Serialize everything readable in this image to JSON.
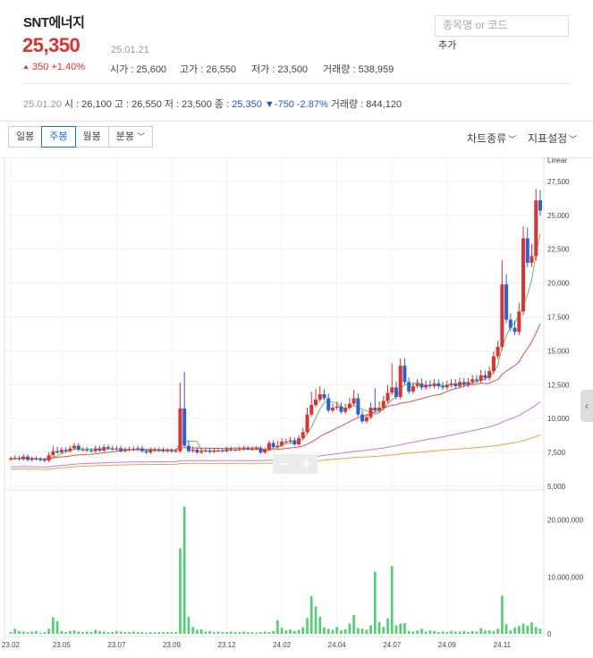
{
  "stock": {
    "name": "SNT에너지",
    "price": "25,350",
    "date": "25.01.21",
    "change": "350 +1.40%",
    "change_arrow": "▲"
  },
  "stats": {
    "open": "시가 : 25,600",
    "high": "고가 : 26,550",
    "low": "저가 : 23,500",
    "volume": "거래량 : 538,959"
  },
  "search": {
    "placeholder": "종목명 or 코드",
    "add_label": "추가"
  },
  "prev": {
    "date": "25.01.20",
    "open": "시 : 26,100",
    "high": "고 : 26,550",
    "low": "저 : 23,500",
    "close_label": "종 : ",
    "close": "25,350",
    "change": "▼-750 -2.87%",
    "volume": "거래량 : 844,120"
  },
  "toolbar": {
    "periods": [
      "일봉",
      "주봉",
      "월봉",
      "분봉"
    ],
    "active": "주봉",
    "chart_type": "차트종류",
    "indicators": "지표설정"
  },
  "colors": {
    "up": "#e0302f",
    "down": "#2a62d5",
    "ma5": "#5cc05c",
    "ma20": "#e0504c",
    "ma60": "#c57ad9",
    "ma120": "#e8a24c",
    "volume": "#4fcf70"
  },
  "chart_data": {
    "type": "candlestick",
    "scale_label": "Linear",
    "ylim": [
      5000,
      28750
    ],
    "y_ticks": [
      5000,
      7500,
      10000,
      12500,
      15000,
      17500,
      20000,
      22500,
      25000,
      27500
    ],
    "y_tick_labels": [
      "5,000",
      "7,500",
      "10,000",
      "12,500",
      "15,000",
      "17,500",
      "20,000",
      "22,500",
      "25,000",
      "27,500"
    ],
    "volume_ticks": [
      0,
      10000000,
      20000000
    ],
    "volume_tick_labels": [
      "0",
      "10,000,000",
      "20,000,000"
    ],
    "volume_max": 24000000,
    "x_labels": [
      {
        "i": 0,
        "label": "23.02"
      },
      {
        "i": 12,
        "label": "23.05"
      },
      {
        "i": 25,
        "label": "23.07"
      },
      {
        "i": 38,
        "label": "23.09"
      },
      {
        "i": 51,
        "label": "23.12"
      },
      {
        "i": 64,
        "label": "24.02"
      },
      {
        "i": 77,
        "label": "24.04"
      },
      {
        "i": 90,
        "label": "24.07"
      },
      {
        "i": 103,
        "label": "24.09"
      },
      {
        "i": 116,
        "label": "24.11"
      }
    ],
    "weekly_closes": [
      7050,
      7080,
      7000,
      7200,
      6950,
      7050,
      7000,
      6950,
      6900,
      7300,
      7600,
      7500,
      7700,
      7600,
      7800,
      8000,
      7700,
      7700,
      7650,
      7600,
      7800,
      7650,
      7900,
      7800,
      7750,
      7800,
      7600,
      7700,
      7750,
      7700,
      7800,
      7600,
      7500,
      7700,
      7650,
      7700,
      7600,
      7650,
      7600,
      7600,
      10750,
      8000,
      7600,
      7700,
      7500,
      7600,
      7650,
      7550,
      7650,
      7650,
      7600,
      7750,
      7700,
      7700,
      7750,
      7800,
      7750,
      7750,
      7800,
      7500,
      7700,
      8200,
      7900,
      8000,
      8300,
      8300,
      8400,
      8100,
      8550,
      9000,
      10300,
      11000,
      11400,
      11800,
      11500,
      10600,
      10800,
      10900,
      10500,
      10800,
      11100,
      11500,
      10300,
      9800,
      10100,
      10800,
      10600,
      10800,
      11300,
      11900,
      12300,
      11600,
      13900,
      12700,
      12000,
      12400,
      12600,
      12300,
      12500,
      12400,
      12600,
      12400,
      12300,
      12500,
      12600,
      12400,
      12700,
      12500,
      12700,
      12900,
      12800,
      13200,
      13000,
      13500,
      14600,
      15300,
      19900,
      17300,
      16700,
      16400,
      17900,
      23300,
      21500,
      22000,
      26100,
      25350
    ],
    "volume_values": [
      300000,
      900000,
      500000,
      400000,
      300000,
      400000,
      500000,
      200000,
      300000,
      900000,
      2900000,
      2200000,
      500000,
      300000,
      500000,
      600000,
      400000,
      300000,
      400000,
      300000,
      700000,
      500000,
      400000,
      300000,
      300000,
      500000,
      400000,
      300000,
      300000,
      400000,
      300000,
      300000,
      200000,
      300000,
      300000,
      300000,
      300000,
      300000,
      300000,
      300000,
      15000000,
      22300000,
      3000000,
      1200000,
      700000,
      800000,
      400000,
      500000,
      300000,
      400000,
      300000,
      300000,
      400000,
      300000,
      300000,
      400000,
      300000,
      300000,
      200000,
      300000,
      400000,
      300000,
      500000,
      2400000,
      1100000,
      600000,
      800000,
      500000,
      700000,
      1200000,
      2800000,
      6600000,
      4800000,
      3000000,
      1100000,
      900000,
      700000,
      1200000,
      600000,
      800000,
      1800000,
      3300000,
      1000000,
      900000,
      700000,
      1500000,
      10900000,
      2100000,
      1200000,
      2700000,
      11900000,
      1500000,
      1800000,
      1900000,
      500000,
      400000,
      600000,
      900000,
      400000,
      600000,
      500000,
      300000,
      400000,
      300000,
      500000,
      400000,
      400000,
      500000,
      300000,
      500000,
      400000,
      1000000,
      600000,
      600000,
      500000,
      900000,
      6700000,
      1700000,
      600000,
      1100000,
      1400000,
      1800000,
      1400000,
      2000000,
      1200000,
      900000
    ]
  }
}
